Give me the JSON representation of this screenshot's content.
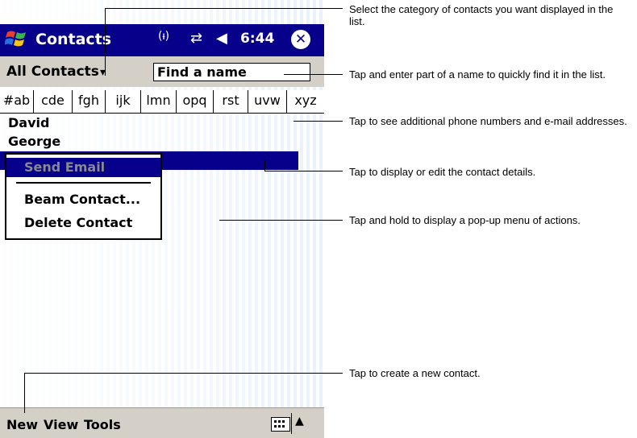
{
  "titlebar": {
    "app_title": "Contacts",
    "time": "6:44",
    "close_symbol": "✕",
    "icons": [
      "windows-start-icon",
      "signal-icon",
      "sync-icon",
      "speaker-icon",
      "close-icon"
    ]
  },
  "category": {
    "label": "All Contacts",
    "arrow": "▾",
    "find_placeholder": "Find a name"
  },
  "tabs": [
    "#ab",
    "cde",
    "fgh",
    "ijk",
    "lmn",
    "opq",
    "rst",
    "uvw",
    "xyz"
  ],
  "contacts": [
    "David",
    "George"
  ],
  "context_menu": {
    "send_email": "Send Email",
    "beam_contact": "Beam Contact...",
    "delete_contact": "Delete Contact"
  },
  "menubar": {
    "new": "New",
    "view": "View",
    "tools": "Tools",
    "input_arrow": "▲"
  },
  "callouts": {
    "category": "Select the category of contacts you want displayed in the list.",
    "find": "Tap and enter part of a name to quickly find it in the list.",
    "phone": "Tap to see additional phone numbers and e-mail addresses.",
    "details": "Tap to display or edit the contact details.",
    "hold": "Tap and hold to display a pop-up menu of actions.",
    "new": "Tap to create a new contact."
  },
  "colors": {
    "titlebar": "#07008a",
    "bars": "#d4d0c8",
    "stripe": "#e8f2fb"
  }
}
